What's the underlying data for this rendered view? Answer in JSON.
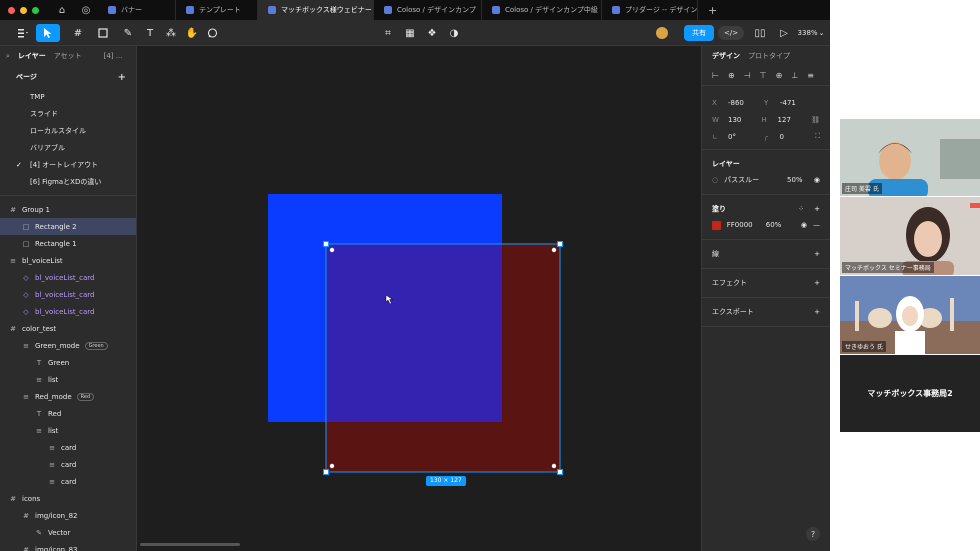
{
  "tabs": {
    "items": [
      {
        "label": "バナー",
        "active": false
      },
      {
        "label": "テンプレート",
        "active": false
      },
      {
        "label": "マッチボックス様ウェビナー",
        "active": true
      },
      {
        "label": "Coloso / デザインカンプ",
        "active": false
      },
      {
        "label": "Coloso / デザインカンプ中級",
        "active": false
      },
      {
        "label": "プリダージ -- デザイン",
        "active": false
      }
    ],
    "add_icon": "plus-icon",
    "close_glyph": "×"
  },
  "toolbar": {
    "share_label": "共有",
    "dev_label": "</>",
    "zoom_label": "338%",
    "zoom_caret": "⌄"
  },
  "left_panel": {
    "tabs": [
      "レイヤー",
      "アセット",
      "[4] ..."
    ],
    "pages_title": "ページ",
    "add_page": "+",
    "pages": [
      {
        "label": "TMP",
        "current": false
      },
      {
        "label": "スライド",
        "current": false
      },
      {
        "label": "ローカルスタイル",
        "current": false
      },
      {
        "label": "バリアブル",
        "current": false
      },
      {
        "label": "[4] オートレイアウト",
        "current": true
      },
      {
        "label": "[6] FigmaとXDの違い",
        "current": false
      }
    ],
    "check_glyph": "✓",
    "layers": [
      {
        "label": "Group 1",
        "indent": 0,
        "icon": "frame-icon",
        "selected": false,
        "component": false,
        "badge": ""
      },
      {
        "label": "Rectangle 2",
        "indent": 1,
        "icon": "rectangle-icon",
        "selected": true,
        "component": false,
        "badge": ""
      },
      {
        "label": "Rectangle 1",
        "indent": 1,
        "icon": "rectangle-icon",
        "selected": false,
        "component": false,
        "badge": ""
      },
      {
        "label": "bl_voiceList",
        "indent": 0,
        "icon": "autolayout-icon",
        "selected": false,
        "component": false,
        "badge": ""
      },
      {
        "label": "bl_voiceList_card",
        "indent": 1,
        "icon": "instance-icon",
        "selected": false,
        "component": true,
        "badge": ""
      },
      {
        "label": "bl_voiceList_card",
        "indent": 1,
        "icon": "instance-icon",
        "selected": false,
        "component": true,
        "badge": ""
      },
      {
        "label": "bl_voiceList_card",
        "indent": 1,
        "icon": "instance-icon",
        "selected": false,
        "component": true,
        "badge": ""
      },
      {
        "label": "color_test",
        "indent": 0,
        "icon": "frame-icon",
        "selected": false,
        "component": false,
        "badge": ""
      },
      {
        "label": "Green_mode",
        "indent": 1,
        "icon": "autolayout-icon",
        "selected": false,
        "component": false,
        "badge": "Green"
      },
      {
        "label": "Green",
        "indent": 2,
        "icon": "text-icon",
        "selected": false,
        "component": false,
        "badge": ""
      },
      {
        "label": "list",
        "indent": 2,
        "icon": "autolayout-icon",
        "selected": false,
        "component": false,
        "badge": ""
      },
      {
        "label": "Red_mode",
        "indent": 1,
        "icon": "autolayout-icon",
        "selected": false,
        "component": false,
        "badge": "Red"
      },
      {
        "label": "Red",
        "indent": 2,
        "icon": "text-icon",
        "selected": false,
        "component": false,
        "badge": ""
      },
      {
        "label": "list",
        "indent": 2,
        "icon": "autolayout-icon",
        "selected": false,
        "component": false,
        "badge": ""
      },
      {
        "label": "card",
        "indent": 3,
        "icon": "autolayout-icon",
        "selected": false,
        "component": false,
        "badge": ""
      },
      {
        "label": "card",
        "indent": 3,
        "icon": "autolayout-icon",
        "selected": false,
        "component": false,
        "badge": ""
      },
      {
        "label": "card",
        "indent": 3,
        "icon": "autolayout-icon",
        "selected": false,
        "component": false,
        "badge": ""
      },
      {
        "label": "icons",
        "indent": 0,
        "icon": "frame-icon",
        "selected": false,
        "component": false,
        "badge": ""
      },
      {
        "label": "img/icon_82",
        "indent": 1,
        "icon": "frame-icon",
        "selected": false,
        "component": false,
        "badge": ""
      },
      {
        "label": "Vector",
        "indent": 2,
        "icon": "vector-icon",
        "selected": false,
        "component": false,
        "badge": ""
      },
      {
        "label": "img/icon_83",
        "indent": 1,
        "icon": "frame-icon",
        "selected": false,
        "component": false,
        "badge": ""
      }
    ]
  },
  "canvas": {
    "blue_rect_color": "#0a3cff",
    "red_rect_color": "#5a1512",
    "overlap_color": "#3422b0",
    "selection_color": "#0d99ff",
    "size_label": "130 × 127"
  },
  "right_panel": {
    "tabs": [
      "デザイン",
      "プロトタイプ"
    ],
    "x_label": "X",
    "x_value": "-860",
    "y_label": "Y",
    "y_value": "-471",
    "w_label": "W",
    "w_value": "130",
    "h_label": "H",
    "h_value": "127",
    "rotation_value": "0°",
    "radius_value": "0",
    "layer_title": "レイヤー",
    "blend_mode": "パススルー",
    "layer_opacity": "50%",
    "fill_title": "塗り",
    "fill_color": "#c4261b",
    "fill_hex": "FF0000",
    "fill_opacity": "60%",
    "stroke_title": "線",
    "effects_title": "エフェクト",
    "export_title": "エクスポート",
    "help_label": "?"
  },
  "participants": [
    {
      "name": "庄司 美雲 氏"
    },
    {
      "name": "マッチボックス セミナー事務局"
    },
    {
      "name": "せきゆおう 氏"
    },
    {
      "name": "マッチボックス事務局2"
    }
  ]
}
